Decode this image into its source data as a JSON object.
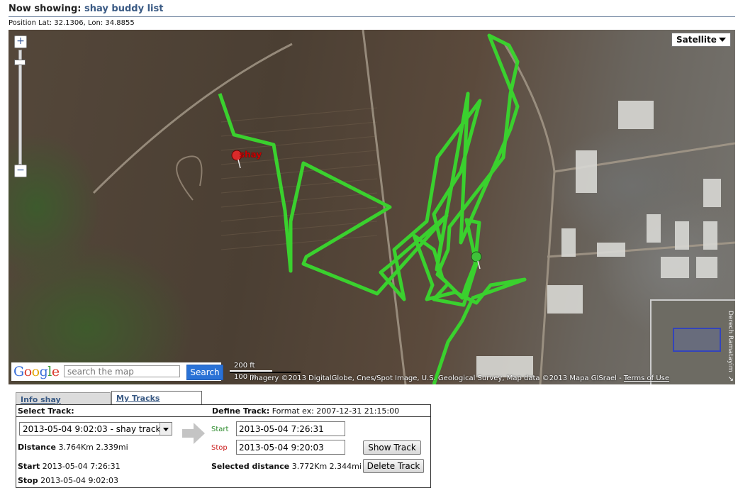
{
  "header": {
    "prefix": "Now showing:",
    "list_name": "shay buddy list"
  },
  "position": "Position Lat: 32.1306, Lon: 34.8855",
  "map": {
    "type_label": "Satellite",
    "zoom_in": "+",
    "zoom_out": "−",
    "marker_label": "shay",
    "overview_label": "Derech Ramatayim",
    "search": {
      "placeholder": "search the map",
      "button": "Search"
    },
    "scale": {
      "feet": "200 ft",
      "meters": "100 m"
    },
    "attribution": "Imagery ©2013 DigitalGlobe, Cnes/Spot Image, U.S. Geological Survey, Map data ©2013 Mapa GISrael -",
    "terms": "Terms of Use",
    "track_color": "#3ad12e"
  },
  "panel": {
    "tabs": [
      "Info shay",
      "My Tracks"
    ],
    "select_track_label": "Select Track:",
    "selected_track": "2013-05-04 9:02:03 - shay track",
    "define_track_label": "Define Track:",
    "format_hint": "Format ex: 2007-12-31 21:15:00",
    "distance_label": "Distance",
    "distance_value": "3.764Km 2.339mi",
    "start_label": "Start",
    "start_value": "2013-05-04 7:26:31",
    "stop_label": "Stop",
    "stop_value": "2013-05-04 9:02:03",
    "field_start_label": "Start",
    "field_start_value": "2013-05-04 7:26:31",
    "field_stop_label": "Stop",
    "field_stop_value": "2013-05-04 9:20:03",
    "show_track_button": "Show Track",
    "selected_distance_label": "Selected distance",
    "selected_distance_value": "3.772Km 2.344mi",
    "delete_track_button": "Delete Track"
  }
}
